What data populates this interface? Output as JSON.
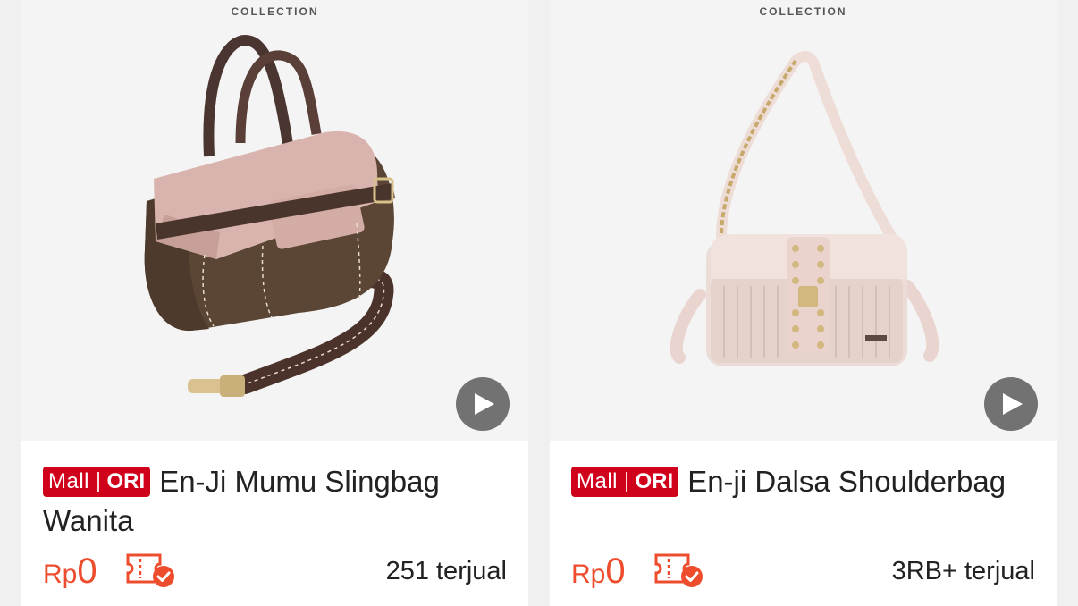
{
  "products": [
    {
      "brand_caption": "COLLECTION",
      "badge_mall": "Mall",
      "badge_ori": "ORI",
      "title": "En-Ji Mumu Slingbag Wanita",
      "price_currency": "Rp",
      "price_amount": "0",
      "sold": "251 terjual"
    },
    {
      "brand_caption": "COLLECTION",
      "badge_mall": "Mall",
      "badge_ori": "ORI",
      "title": "En-ji Dalsa Shoulderbag",
      "price_currency": "Rp",
      "price_amount": "0",
      "sold": "3RB+ terjual"
    }
  ],
  "colors": {
    "mall_badge": "#d0011b",
    "price": "#ee4d2d",
    "play_button": "#5a5a5a"
  },
  "icons": [
    "play-icon",
    "voucher-check-icon"
  ]
}
